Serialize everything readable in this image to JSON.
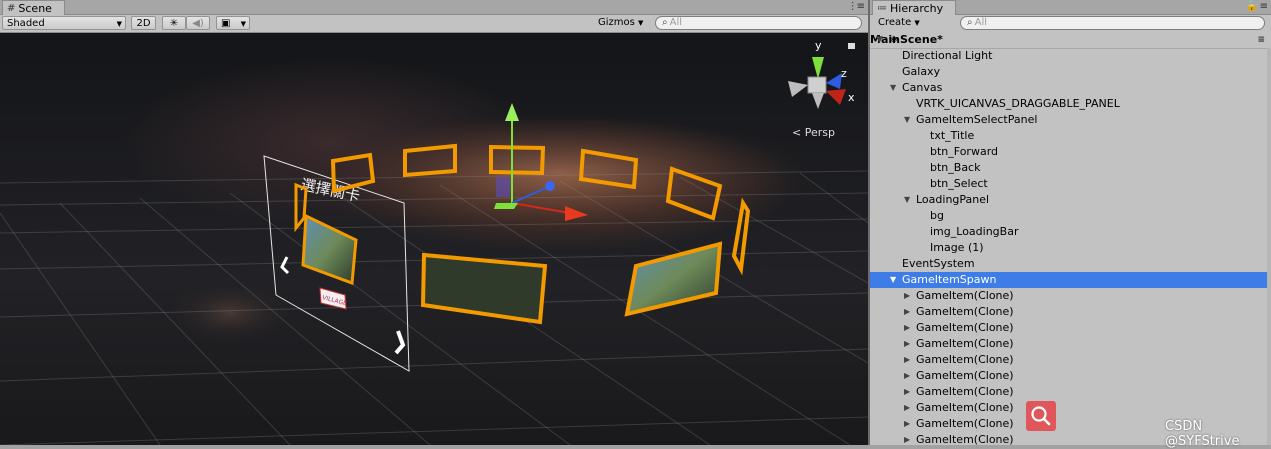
{
  "scene": {
    "tab_title": "Scene",
    "shading_mode": "Shaded",
    "btn_2d": "2D",
    "gizmos_label": "Gizmos",
    "search_placeholder": "All",
    "persp_label": "Persp",
    "axis_y": "y",
    "axis_z": "z",
    "axis_x": "x",
    "canvas_sign": "VILLAGE",
    "canvas_title": "選擇關卡"
  },
  "hierarchy": {
    "tab_title": "Hierarchy",
    "create_label": "Create",
    "search_placeholder": "All",
    "root": "MainScene*",
    "items": [
      {
        "label": "Directional Light",
        "indent": 1,
        "arrow": ""
      },
      {
        "label": "Galaxy",
        "indent": 1,
        "arrow": ""
      },
      {
        "label": "Canvas",
        "indent": 1,
        "arrow": "down"
      },
      {
        "label": "VRTK_UICANVAS_DRAGGABLE_PANEL",
        "indent": 2,
        "arrow": ""
      },
      {
        "label": "GameItemSelectPanel",
        "indent": 2,
        "arrow": "down"
      },
      {
        "label": "txt_Title",
        "indent": 3,
        "arrow": ""
      },
      {
        "label": "btn_Forward",
        "indent": 3,
        "arrow": ""
      },
      {
        "label": "btn_Back",
        "indent": 3,
        "arrow": ""
      },
      {
        "label": "btn_Select",
        "indent": 3,
        "arrow": ""
      },
      {
        "label": "LoadingPanel",
        "indent": 2,
        "arrow": "down"
      },
      {
        "label": "bg",
        "indent": 3,
        "arrow": ""
      },
      {
        "label": "img_LoadingBar",
        "indent": 3,
        "arrow": ""
      },
      {
        "label": "Image (1)",
        "indent": 3,
        "arrow": ""
      },
      {
        "label": "EventSystem",
        "indent": 1,
        "arrow": ""
      },
      {
        "label": "GameItemSpawn",
        "indent": 1,
        "arrow": "down",
        "selected": true
      },
      {
        "label": "GameItem(Clone)",
        "indent": 2,
        "arrow": "right"
      },
      {
        "label": "GameItem(Clone)",
        "indent": 2,
        "arrow": "right"
      },
      {
        "label": "GameItem(Clone)",
        "indent": 2,
        "arrow": "right"
      },
      {
        "label": "GameItem(Clone)",
        "indent": 2,
        "arrow": "right"
      },
      {
        "label": "GameItem(Clone)",
        "indent": 2,
        "arrow": "right"
      },
      {
        "label": "GameItem(Clone)",
        "indent": 2,
        "arrow": "right"
      },
      {
        "label": "GameItem(Clone)",
        "indent": 2,
        "arrow": "right"
      },
      {
        "label": "GameItem(Clone)",
        "indent": 2,
        "arrow": "right"
      },
      {
        "label": "GameItem(Clone)",
        "indent": 2,
        "arrow": "right"
      },
      {
        "label": "GameItem(Clone)",
        "indent": 2,
        "arrow": "right"
      }
    ]
  },
  "watermark": "CSDN @SYFStrive",
  "colors": {
    "selection": "#3e7de7",
    "gizmo_y": "#7ee03a",
    "gizmo_x": "#d02a1a",
    "gizmo_z": "#2e5ce0",
    "outline": "#f29a00"
  }
}
